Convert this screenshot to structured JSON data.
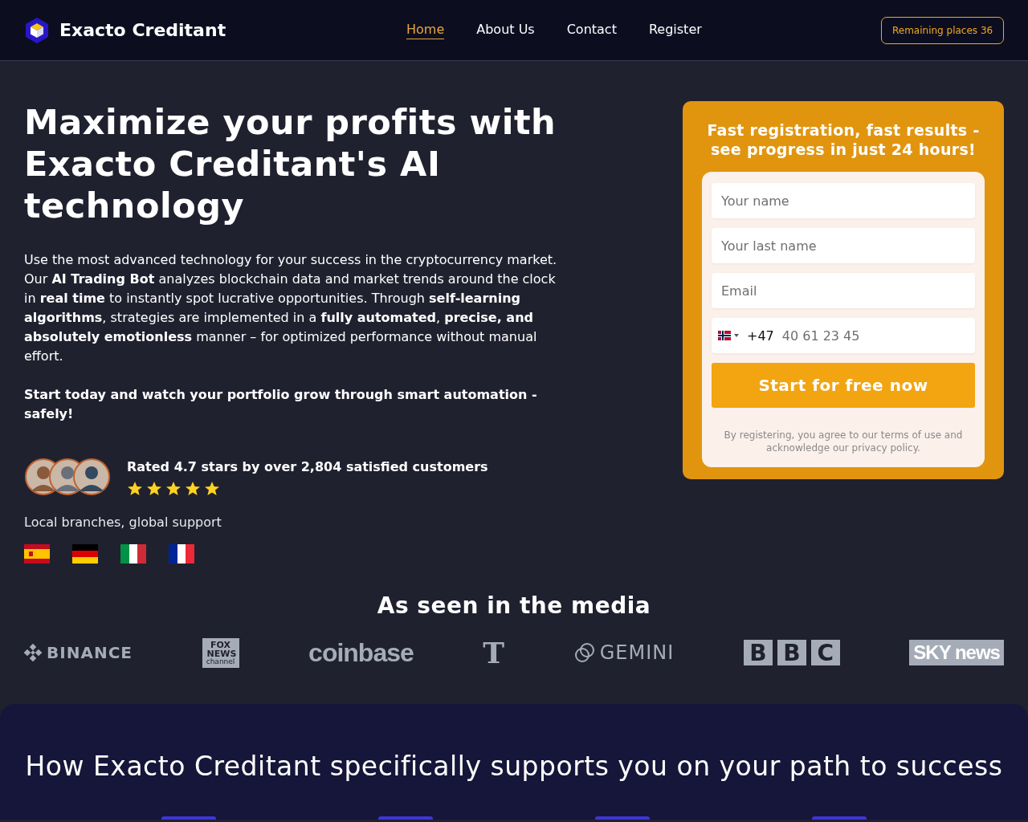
{
  "brand": {
    "name": "Exacto Creditant"
  },
  "nav": [
    {
      "label": "Home",
      "selected": true
    },
    {
      "label": "About Us",
      "selected": false
    },
    {
      "label": "Contact",
      "selected": false
    },
    {
      "label": "Register",
      "selected": false
    }
  ],
  "badge": "Remaining places 36",
  "hero": {
    "title": "Maximize your profits with Exacto Creditant's AI technology",
    "paragraph": "Use the most advanced technology for your success in the cryptocurrency market. Our **AI Trading Bot** analyzes blockchain data and market trends around the clock in **real time** to instantly spot lucrative opportunities. Through **self-learning algorithms**, strategies are implemented in a **fully automated**, **precise, and absolutely emotionless** manner – for optimized performance without manual effort.",
    "cta_text": "Start today and watch your portfolio grow through smart automation - safely!"
  },
  "rating": {
    "text": "Rated 4.7 stars by over 2,804 satisfied customers",
    "stars": 5
  },
  "branches": {
    "label": "Local branches, global support",
    "flags": [
      {
        "kind": "es"
      },
      {
        "kind": "de"
      },
      {
        "kind": "it"
      },
      {
        "kind": "fr"
      }
    ]
  },
  "form": {
    "title": "Fast registration, fast results - see progress in just 24 hours!",
    "fields": [
      {
        "placeholder": "Your name"
      },
      {
        "placeholder": "Your last name"
      },
      {
        "placeholder": "Email"
      }
    ],
    "phone": {
      "prefix": "+47",
      "placeholder": "40 61 23 45"
    },
    "submit": "Start for free now",
    "legal": "By registering, you agree to our terms of use and acknowledge our privacy policy."
  },
  "media": {
    "title": "As seen in the media",
    "logos": [
      {
        "kind": "binance",
        "text": "BINANCE"
      },
      {
        "kind": "fox",
        "text": "FOX NEWS",
        "sub": "channel"
      },
      {
        "kind": "coinbase",
        "text": "coinbase"
      },
      {
        "kind": "nyt",
        "text": "T"
      },
      {
        "kind": "gemini",
        "text": "GEMINI"
      },
      {
        "kind": "bbc",
        "text": "B B C"
      },
      {
        "kind": "sky",
        "text": "SKY news"
      }
    ]
  },
  "features": {
    "title": "How Exacto Creditant specifically supports you on your path to success"
  }
}
